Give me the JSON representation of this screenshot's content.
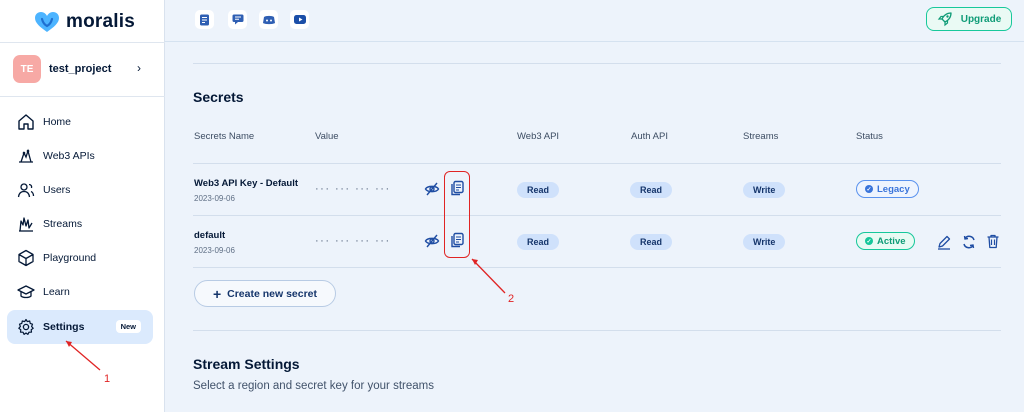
{
  "brand": {
    "name": "moralis"
  },
  "project": {
    "initials": "TE",
    "name": "test_project"
  },
  "nav": {
    "items": [
      {
        "label": "Home",
        "icon": "home-icon"
      },
      {
        "label": "Web3 APIs",
        "icon": "web3-apis-icon"
      },
      {
        "label": "Users",
        "icon": "users-icon"
      },
      {
        "label": "Streams",
        "icon": "streams-icon"
      },
      {
        "label": "Playground",
        "icon": "playground-icon"
      },
      {
        "label": "Learn",
        "icon": "learn-icon"
      },
      {
        "label": "Settings",
        "icon": "gear-icon",
        "badge": "New",
        "active": true
      }
    ]
  },
  "topbar": {
    "icons": [
      "docs-icon",
      "forum-icon",
      "discord-icon",
      "youtube-icon"
    ],
    "upgrade_label": "Upgrade"
  },
  "secrets": {
    "title": "Secrets",
    "columns": [
      "Secrets Name",
      "Value",
      "Web3 API",
      "Auth API",
      "Streams",
      "Status"
    ],
    "rows": [
      {
        "name": "Web3 API Key - Default",
        "date": "2023-09-06",
        "value": "··· ··· ··· ···",
        "web3": "Read",
        "auth": "Read",
        "streams": "Write",
        "status": "Legacy"
      },
      {
        "name": "default",
        "date": "2023-09-06",
        "value": "··· ··· ··· ···",
        "web3": "Read",
        "auth": "Read",
        "streams": "Write",
        "status": "Active"
      }
    ],
    "create_label": "Create new secret"
  },
  "stream_settings": {
    "title": "Stream Settings",
    "subtitle": "Select a region and secret key for your streams"
  },
  "annotations": {
    "one": "1",
    "two": "2"
  },
  "colors": {
    "accent": "#2f5fb3",
    "success": "#16c79a",
    "annotation": "#e02424"
  }
}
